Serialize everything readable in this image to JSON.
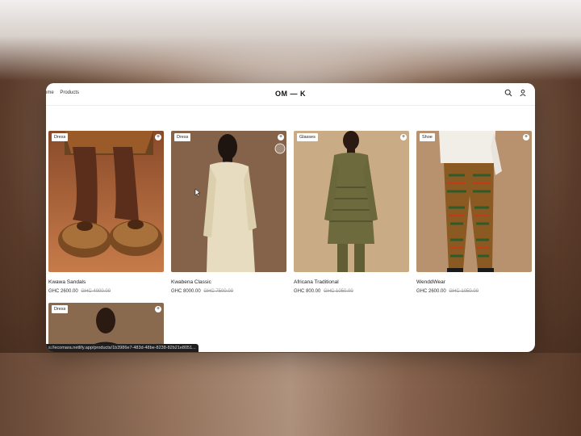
{
  "nav": {
    "items": [
      "ome",
      "Products"
    ]
  },
  "brand": {
    "logo": "OM — K"
  },
  "header_icons": [
    "search-icon",
    "user-icon"
  ],
  "products": [
    {
      "tag": "Dress",
      "title": "Kwawa Sandals",
      "price": "GHC 2600.00",
      "old_price": "GHC 4000.00",
      "image": "sandals"
    },
    {
      "tag": "Dress",
      "title": "Kwabena Classic",
      "price": "GHC 8000.00",
      "old_price": "GHC 7500.00",
      "image": "shirt"
    },
    {
      "tag": "Glasses",
      "title": "Africana Traditional",
      "price": "GHC 800.00",
      "old_price": "GHC 1050.00",
      "image": "traditional"
    },
    {
      "tag": "Shoe",
      "title": "WenddWear",
      "price": "GHC 2600.00",
      "old_price": "GHC 1050.00",
      "image": "trousers"
    },
    {
      "tag": "Dress",
      "title": "",
      "price": "",
      "old_price": "",
      "image": "portrait"
    }
  ],
  "status_url": "s://ecomara.netlify.app/products/1b3986e7-483d-48be-8238-82b21e8051..."
}
